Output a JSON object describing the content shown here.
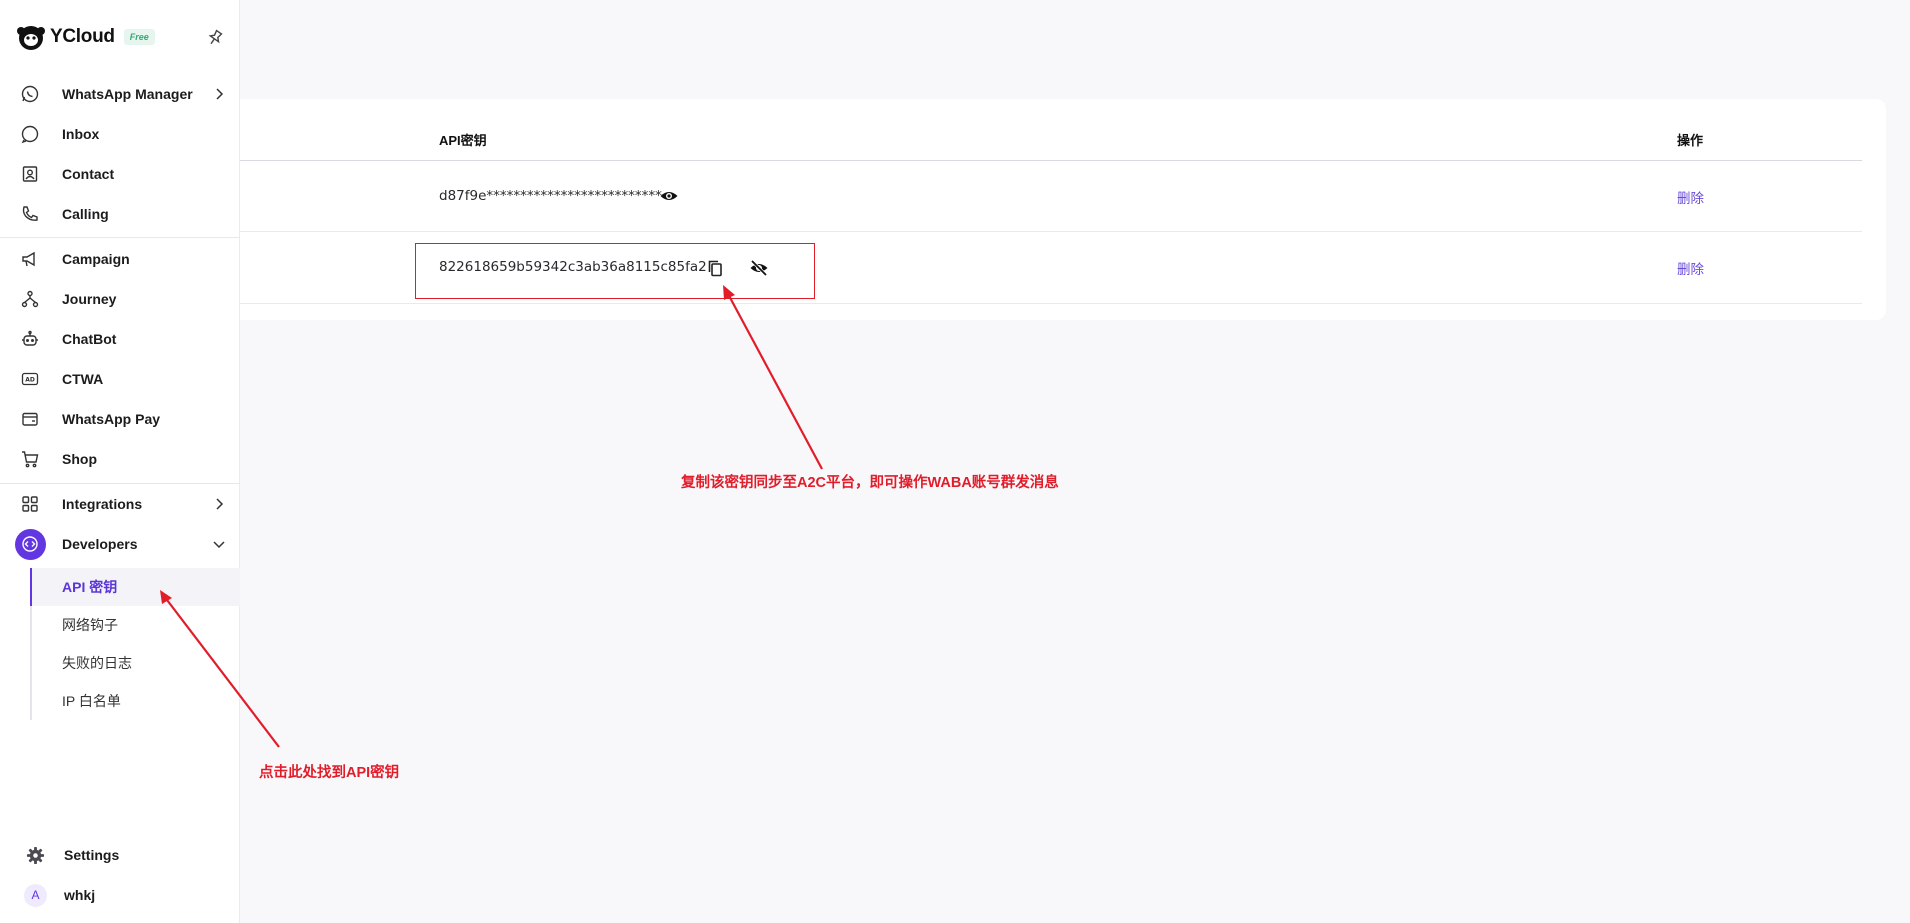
{
  "brand": {
    "name": "YCloud",
    "badge": "Free"
  },
  "sidebar": {
    "items": [
      {
        "label": "WhatsApp Manager",
        "icon": "whatsapp-icon",
        "has_submenu": true
      },
      {
        "label": "Inbox",
        "icon": "chat-bubble-icon"
      },
      {
        "label": "Contact",
        "icon": "contact-card-icon"
      },
      {
        "label": "Calling",
        "icon": "phone-icon"
      },
      {
        "label": "Campaign",
        "icon": "megaphone-icon"
      },
      {
        "label": "Journey",
        "icon": "journey-flow-icon"
      },
      {
        "label": "ChatBot",
        "icon": "robot-icon"
      },
      {
        "label": "CTWA",
        "icon": "ad-icon"
      },
      {
        "label": "WhatsApp Pay",
        "icon": "wallet-icon"
      },
      {
        "label": "Shop",
        "icon": "cart-icon"
      },
      {
        "label": "Integrations",
        "icon": "grid-icon",
        "has_submenu": true
      },
      {
        "label": "Developers",
        "icon": "code-icon",
        "expanded": true
      }
    ],
    "developer_subitems": [
      {
        "label": "API 密钥",
        "active": true
      },
      {
        "label": "网络钩子"
      },
      {
        "label": "失败的日志"
      },
      {
        "label": "IP 白名单"
      }
    ],
    "settings_label": "Settings",
    "user": {
      "avatar_letter": "A",
      "name": "whkj"
    }
  },
  "table": {
    "headers": {
      "api_key": "API密钥",
      "action": "操作"
    },
    "rows": [
      {
        "key": "d87f9e**************************",
        "action": "删除",
        "visible": false
      },
      {
        "key": "822618659b59342c3ab36a8115c85fa2",
        "action": "删除",
        "visible": true
      }
    ]
  },
  "annotations": {
    "copy_note": "复制该密钥同步至A2C平台，即可操作WABA账号群发消息",
    "click_note": "点击此处找到API密钥"
  },
  "colors": {
    "accent": "#6236e0",
    "annotation_red": "#e11d2a",
    "link": "#6a4ad9"
  }
}
